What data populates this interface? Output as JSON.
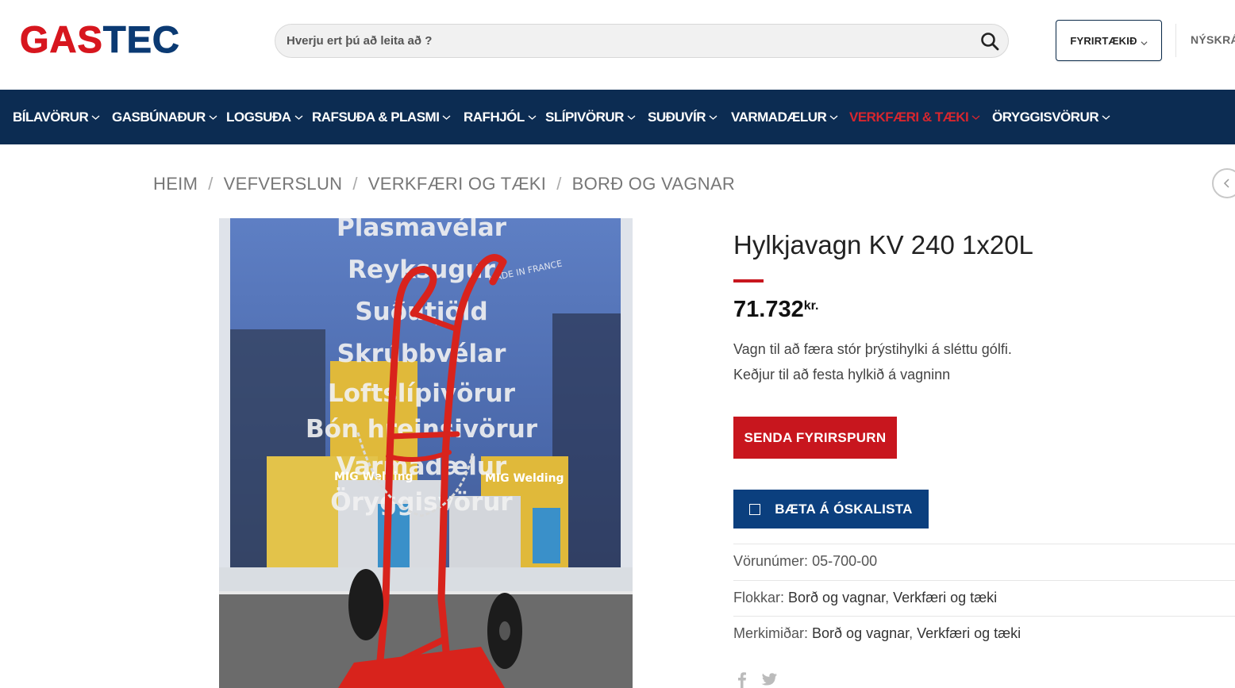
{
  "brand": {
    "part1": "GAS",
    "part2": "TEC"
  },
  "search": {
    "placeholder": "Hverju ert þú að leita að ?"
  },
  "header": {
    "company_label": "FYRIRTÆKIÐ",
    "register_label": "NÝSKRÁ"
  },
  "nav": [
    {
      "label": "BÍLAVÖRUR",
      "active": false
    },
    {
      "label": "GASBÚNAÐUR",
      "active": false
    },
    {
      "label": "LOGSUÐA",
      "active": false
    },
    {
      "label": "RAFSUÐA & PLASMI",
      "active": false
    },
    {
      "label": "RAFHJÓL",
      "active": false
    },
    {
      "label": "SLÍPIVÖRUR",
      "active": false
    },
    {
      "label": "SUÐUVÍR",
      "active": false
    },
    {
      "label": "VARMADÆLUR",
      "active": false
    },
    {
      "label": "VERKFÆRI & TÆKI",
      "active": true
    },
    {
      "label": "ÖRYGGISVÖRUR",
      "active": false
    }
  ],
  "breadcrumb": [
    "HEIM",
    "VEFVERSLUN",
    "VERKFÆRI OG TÆKI",
    "BORÐ OG VAGNAR"
  ],
  "product": {
    "title": "Hylkjavagn KV 240 1x20L",
    "price": "71.732",
    "currency": "kr.",
    "description": [
      "Vagn til að færa stór þrýstihylki á sléttu gólfi.",
      "Keðjur til að festa hylkið á vagninn"
    ],
    "inquiry_label": "SENDA FYRIRSPURN",
    "wishlist_label": "BÆTA Á ÓSKALISTA",
    "sku_label": "Vörunúmer:",
    "sku": "05-700-00",
    "categories_label": "Flokkar:",
    "categories": [
      "Borð og vagnar",
      "Verkfæri og tæki"
    ],
    "tags_label": "Merkimiðar:",
    "tags": [
      "Borð og vagnar",
      "Verkfæri og tæki"
    ]
  },
  "image_text": {
    "lines": [
      "Plasmavélar",
      "Reyksugur",
      "Suðutjöld",
      "Skrúbbvélar",
      "Loftslípivörur",
      "Bón hreinsivörur",
      "Varmadælur",
      "Öryggisvörur"
    ],
    "box_label": "MIG Welding",
    "made_in": "MADE IN FRANCE"
  },
  "colors": {
    "brand_red": "#d7161e",
    "brand_blue": "#0b3a73",
    "nav_bg": "#0c2c52",
    "button_red": "#c8161e",
    "button_blue": "#0b3f7e"
  },
  "icons": [
    "search-icon",
    "chevron-down-icon",
    "chevron-left-icon",
    "heart-icon",
    "facebook-icon",
    "twitter-icon"
  ]
}
